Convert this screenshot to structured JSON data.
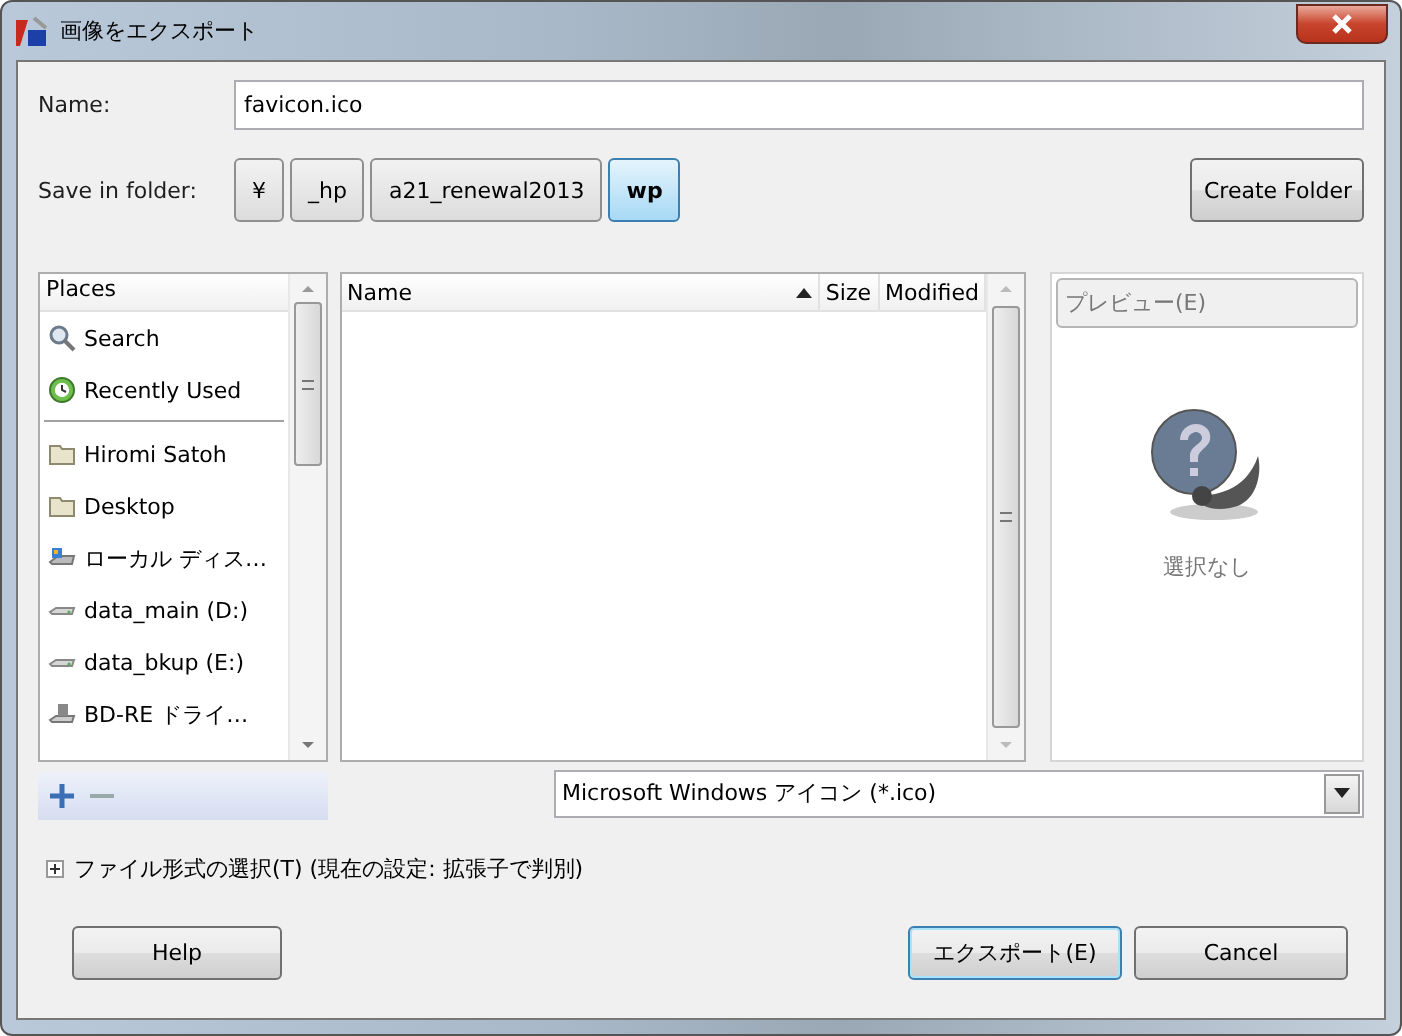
{
  "window": {
    "title": "画像をエクスポート"
  },
  "name_field": {
    "label": "Name:",
    "value": "favicon.ico"
  },
  "save_in_folder": {
    "label": "Save in folder:",
    "path": [
      {
        "label": "¥",
        "selected": false
      },
      {
        "label": "_hp",
        "selected": false
      },
      {
        "label": "a21_renewal2013",
        "selected": false
      },
      {
        "label": "wp",
        "selected": true
      }
    ]
  },
  "create_folder": "Create Folder",
  "places": {
    "header": "Places",
    "shortcuts": [
      {
        "label": "Search",
        "kind": "search"
      },
      {
        "label": "Recently Used",
        "kind": "recent"
      }
    ],
    "locations": [
      {
        "label": "Hiromi Satoh",
        "kind": "folder"
      },
      {
        "label": "Desktop",
        "kind": "folder"
      },
      {
        "label": "ローカル ディス…",
        "kind": "system-drive"
      },
      {
        "label": "data_main (D:)",
        "kind": "drive"
      },
      {
        "label": "data_bkup (E:)",
        "kind": "drive"
      },
      {
        "label": "BD-RE ドライ…",
        "kind": "optical"
      }
    ]
  },
  "file_list": {
    "columns": [
      {
        "label": "Name",
        "sorted": true
      },
      {
        "label": "Size",
        "sorted": false
      },
      {
        "label": "Modified",
        "sorted": false
      }
    ]
  },
  "preview": {
    "label": "プレビュー(E)",
    "status": "選択なし"
  },
  "file_type": "Microsoft Windows アイコン (*.ico)",
  "file_type_expander": {
    "label": "ファイル形式の選択(T) (現在の設定: 拡張子で判別)",
    "expanded": false
  },
  "buttons": [
    {
      "label": "Help",
      "default": false
    },
    {
      "label": "エクスポート(E)",
      "default": true
    },
    {
      "label": "Cancel",
      "default": false
    }
  ]
}
